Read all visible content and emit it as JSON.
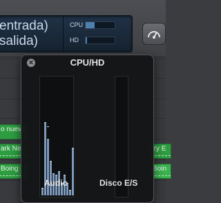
{
  "lcd": {
    "line1": "entrada)",
    "line2": "salida)",
    "cpu_label": "CPU",
    "hd_label": "HD",
    "cpu_level": 0.3,
    "hd_level": 0.05
  },
  "tracks": {
    "regions": [
      {
        "label": "o nueva",
        "selected": false
      },
      {
        "label": "ark Ne",
        "selected": false
      },
      {
        "label": "Boing",
        "selected": false
      },
      {
        "label": "zy E",
        "selected": false
      },
      {
        "label": "Boin",
        "selected": true
      }
    ]
  },
  "hud": {
    "title": "CPU/HD",
    "audio_label": "Audio",
    "disk_label": "Disco E/S",
    "audio_levels": [
      0.06,
      0.62,
      0.48,
      0.29,
      0.18,
      0.17,
      0.2,
      0.1,
      0.17,
      0.1,
      0.04,
      0.4
    ],
    "audio_peaks": [
      0.06,
      0.62,
      0.58,
      0.29,
      0.18,
      0.17,
      0.2,
      0.1,
      0.17,
      0.1,
      0.04,
      0.4
    ],
    "disk_level": 0
  }
}
